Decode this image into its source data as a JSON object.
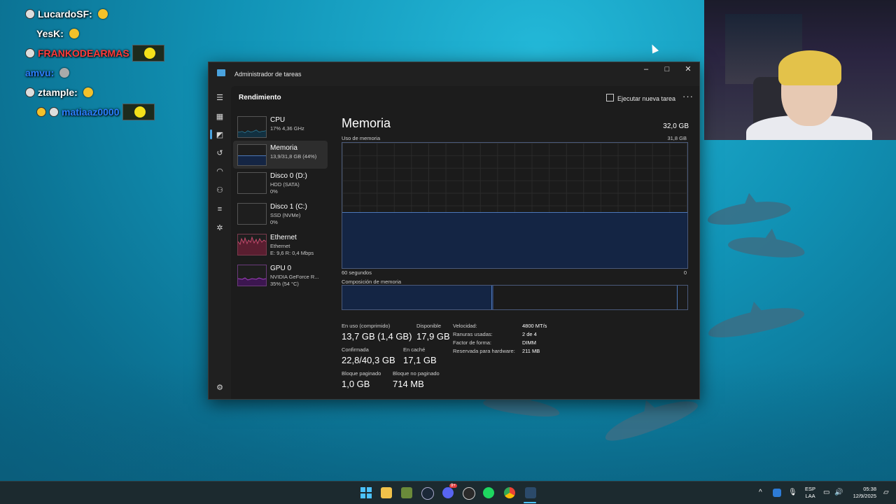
{
  "chat": [
    {
      "user": "LucardoSF:",
      "color": "#ffffff"
    },
    {
      "user": "YesK:",
      "color": "#ffffff"
    },
    {
      "user": "FRANKODEARMAS",
      "color": "#ff3b3b"
    },
    {
      "user": "amvu:",
      "color": "#2a7fff"
    },
    {
      "user": "ztample:",
      "color": "#ffffff"
    },
    {
      "user": "matiaaz0000",
      "color": "#2a7fff"
    }
  ],
  "window": {
    "title": "Administrador de tareas",
    "minimize": "–",
    "maximize": "□",
    "close": "✕"
  },
  "header": {
    "section": "Rendimiento",
    "run_task": "Ejecutar nueva tarea",
    "more": "···"
  },
  "nav_icons": [
    "menu-icon",
    "processes-icon",
    "performance-icon",
    "history-icon",
    "startup-icon",
    "users-icon",
    "details-icon",
    "services-icon",
    "settings-icon"
  ],
  "perf_items": [
    {
      "name": "CPU",
      "sub1": "17% 4,36 GHz",
      "sub2": "",
      "color": "#35a3c7"
    },
    {
      "name": "Memoria",
      "sub1": "13,9/31,8 GB (44%)",
      "sub2": "",
      "color": "#4c78b8"
    },
    {
      "name": "Disco 0 (D:)",
      "sub1": "HDD (SATA)",
      "sub2": "0%",
      "color": "#6cbf4a"
    },
    {
      "name": "Disco 1 (C:)",
      "sub1": "SSD (NVMe)",
      "sub2": "0%",
      "color": "#6cbf4a"
    },
    {
      "name": "Ethernet",
      "sub1": "Ethernet",
      "sub2": "E: 9,6 R: 0,4 Mbps",
      "color": "#c24a6c"
    },
    {
      "name": "GPU 0",
      "sub1": "NVIDIA GeForce R...",
      "sub2": "35% (54 °C)",
      "color": "#a13fbf"
    }
  ],
  "memory": {
    "title": "Memoria",
    "total": "32,0 GB",
    "usage_label": "Uso de memoria",
    "usage_max": "31,8 GB",
    "usage_fraction": 0.44,
    "time_label": "60 segundos",
    "time_end": "0",
    "composition_label": "Composición de memoria",
    "stats": [
      {
        "k": "En uso (comprimido)",
        "v": "13,7 GB (1,4 GB)"
      },
      {
        "k": "Disponible",
        "v": "17,9 GB"
      },
      {
        "k": "Confirmada",
        "v": "22,8/40,3 GB"
      },
      {
        "k": "En caché",
        "v": "17,1 GB"
      },
      {
        "k": "Bloque paginado",
        "v": "1,0 GB"
      },
      {
        "k": "Bloque no paginado",
        "v": "714 MB"
      }
    ],
    "specs": [
      {
        "k": "Velocidad:",
        "v": "4800 MT/s"
      },
      {
        "k": "Ranuras usadas:",
        "v": "2 de 4"
      },
      {
        "k": "Factor de forma:",
        "v": "DIMM"
      },
      {
        "k": "Reservada para hardware:",
        "v": "211 MB"
      }
    ]
  },
  "taskbar": {
    "apps": [
      "windows-start-icon",
      "file-explorer-icon",
      "minecraft-icon",
      "steam-icon",
      "discord-icon",
      "obs-icon",
      "spotify-icon",
      "chrome-icon",
      "task-manager-icon"
    ],
    "discord_badge": "9+",
    "lang_top": "ESP",
    "lang_bottom": "LAA",
    "time": "05:38",
    "date": "12/9/2025",
    "chevron": "^"
  }
}
